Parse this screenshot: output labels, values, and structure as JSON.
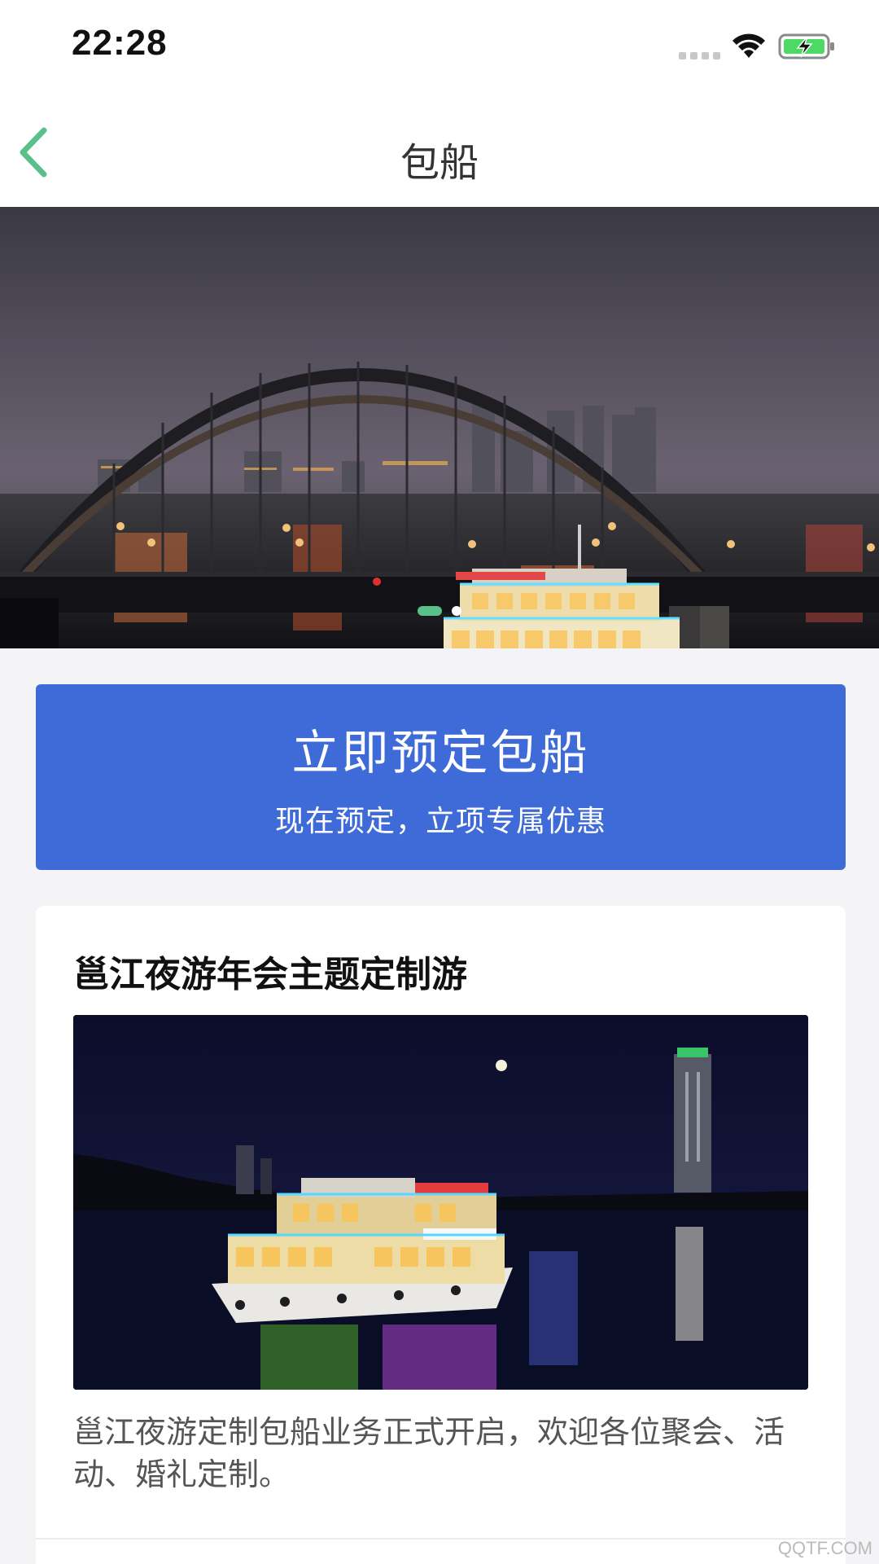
{
  "status_bar": {
    "time": "22:28"
  },
  "nav": {
    "title": "包船",
    "back_icon": "chevron-left-icon"
  },
  "carousel": {
    "slide_count": 2,
    "active_index": 0
  },
  "cta": {
    "title": "立即预定包船",
    "subtitle": "现在预定，立项专属优惠"
  },
  "card": {
    "title": "邕江夜游年会主题定制游",
    "description": "邕江夜游定制包船业务正式开启，欢迎各位聚会、活动、婚礼定制。"
  },
  "watermark": "QQTF.COM",
  "colors": {
    "accent_green": "#5ac08a",
    "cta_blue": "#3f6bd8"
  }
}
